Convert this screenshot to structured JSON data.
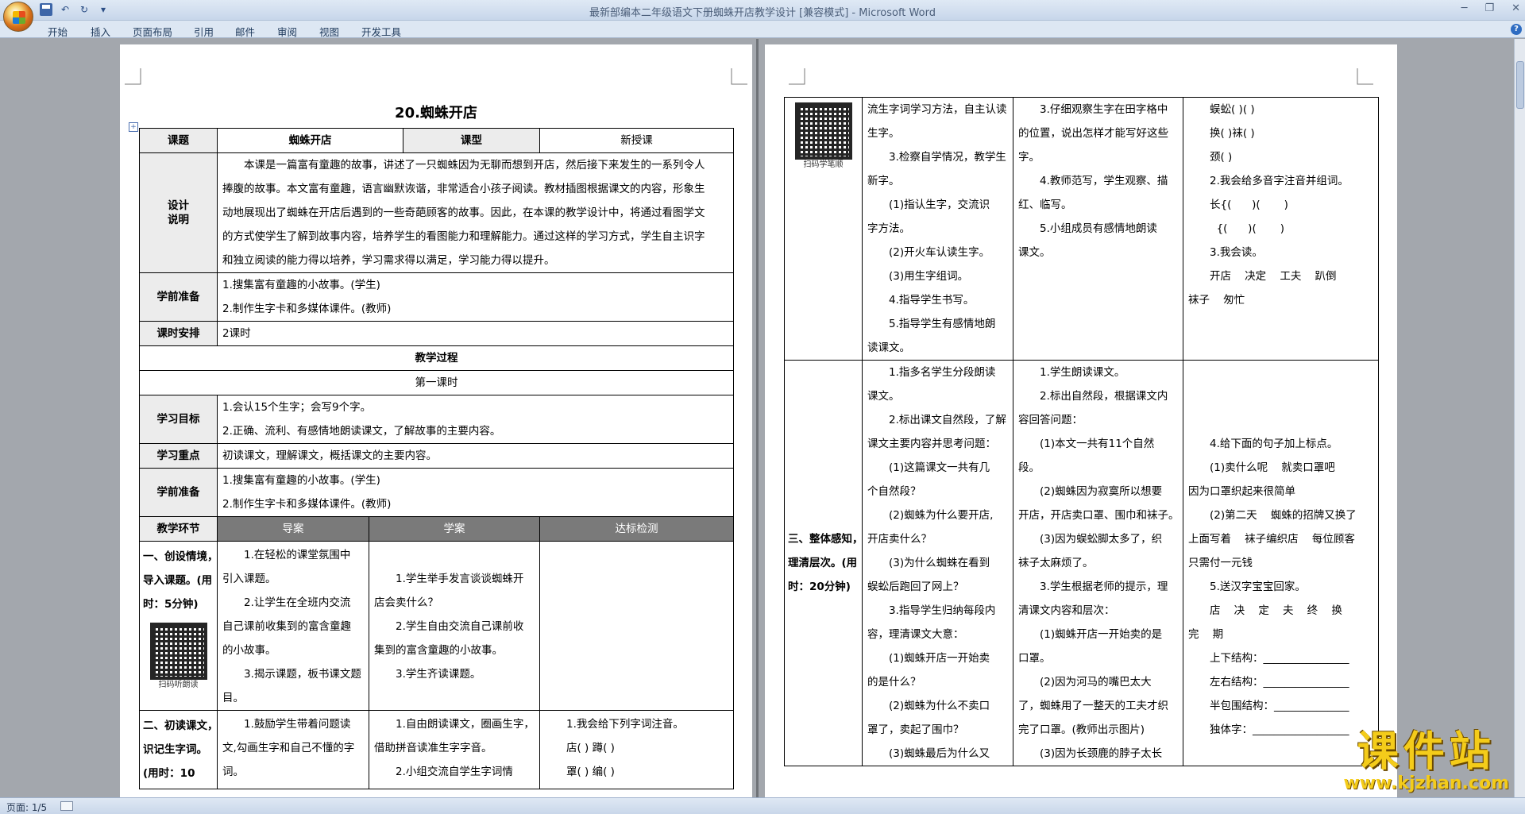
{
  "window": {
    "title": "最新部编本二年级语文下册蜘蛛开店教学设计 [兼容模式] - Microsoft Word"
  },
  "ribbon": {
    "tabs": [
      "开始",
      "插入",
      "页面布局",
      "引用",
      "邮件",
      "审阅",
      "视图",
      "开发工具"
    ]
  },
  "status": {
    "page": "页面: 1/5"
  },
  "doc": {
    "title": "20.蜘蛛开店",
    "lesson_label": "课题",
    "lesson_value": "蜘蛛开店",
    "type_label": "课型",
    "type_value": "新授课",
    "design_label": "设计说明",
    "design_lines": [
      "本课是一篇富有童趣的故事，讲述了一只蜘蛛因为无聊而想到开店，然后接下来发生的一系列令人",
      "捧腹的故事。本文富有童趣，语言幽默诙谐，非常适合小孩子阅读。教材插图根据课文的内容，形象生",
      "动地展现出了蜘蛛在开店后遇到的一些奇葩顾客的故事。因此，在本课的教学设计中，将通过看图学文",
      "的方式使学生了解到故事内容，培养学生的看图能力和理解能力。通过这样的学习方式，学生自主识字",
      "和独立阅读的能力得以培养，学习需求得以满足，学习能力得以提升。"
    ],
    "prep_label": "学前准备",
    "prep_lines": [
      "1.搜集富有童趣的小故事。(学生)",
      "2.制作生字卡和多媒体课件。(教师)"
    ],
    "hours_label": "课时安排",
    "hours_value": "2课时",
    "process": "教学过程",
    "period1": "第一课时",
    "goal_label": "学习目标",
    "goal_lines": [
      "1.会认15个生字；会写9个字。",
      "2.正确、流利、有感情地朗读课文，了解故事的主要内容。"
    ],
    "key_label": "学习重点",
    "key_value": "初读课文，理解课文，概括课文的主要内容。",
    "prep2_label": "学前准备",
    "prep2_lines": [
      "1.搜集富有童趣的小故事。(学生)",
      "2.制作生字卡和多媒体课件。(教师)"
    ],
    "step_head": [
      "教学环节",
      "导案",
      "学案",
      "达标检测"
    ],
    "step1_label": [
      "一、创设情境，",
      "导入课题。(用",
      "时：5分钟)"
    ],
    "step1_qr": "扫码听朗读",
    "step1_guide": [
      "1.在轻松的课堂氛围中",
      "引入课题。",
      "2.让学生在全班内交流",
      "自己课前收集到的富含童趣",
      "的小故事。",
      "3.揭示课题，板书课文题",
      "目。"
    ],
    "step1_learn": [
      "1.学生举手发言谈谈蜘蛛开",
      "店会卖什么？",
      "2.学生自由交流自己课前收",
      "集到的富含童趣的小故事。",
      "3.学生齐读课题。"
    ],
    "step2_label": [
      "二、初读课文，",
      "识记生字词。",
      "(用时：10"
    ],
    "step2_guide": [
      "1.鼓励学生带着问题读",
      "文,勾画生字和自己不懂的字",
      "词。"
    ],
    "step2_learn": [
      "1.自由朗读课文，圈画生字，",
      "借助拼音读准生字字音。",
      "2.小组交流自学生字词情"
    ],
    "step2_check": [
      "1.我会给下列字词注音。",
      "店(   )  蹲(   )",
      "罩(   )  编(   )"
    ],
    "p2_qr": "扫码学笔顺",
    "p2_a_col2": [
      "流生字词学习方法，自主认读",
      "生字。",
      "3.检察自学情况，教学生",
      "新字。",
      "(1)指认生字，交流识",
      "字方法。",
      "(2)开火车认读生字。",
      "(3)用生字组词。",
      "4.指导学生书写。",
      "5.指导学生有感情地朗",
      "读课文。"
    ],
    "p2_a_col3": [
      "3.仔细观察生字在田字格中",
      "的位置，说出怎样才能写好这些",
      "字。",
      "4.教师范写，学生观察、描",
      "红、临写。",
      "5.小组成员有感情地朗读",
      "课文。"
    ],
    "p2_a_col4": [
      "蜈蚣(   )(   )",
      "换(   )袜(   )",
      "颈(   )",
      "2.我会给多音字注音并组词。",
      "长{(      )(       )",
      "  {(      )(       )",
      "3.我会读。",
      "开店    决定    工夫    趴倒",
      "袜子    匆忙"
    ],
    "p2_b_label": [
      "三、整体感知，",
      "理清层次。(用",
      "时：20分钟)"
    ],
    "p2_b_col2": [
      "1.指多名学生分段朗读",
      "课文。",
      "2.标出课文自然段，了解",
      "课文主要内容并思考问题：",
      "(1)这篇课文一共有几",
      "个自然段？",
      "(2)蜘蛛为什么要开店,",
      "开店卖什么？",
      "(3)为什么蜘蛛在看到",
      "蜈蚣后跑回了网上？",
      "3.指导学生归纳每段内",
      "容，理清课文大意：",
      "(1)蜘蛛开店一开始卖",
      "的是什么？",
      "(2)蜘蛛为什么不卖口",
      "罩了，卖起了围巾？",
      "(3)蜘蛛最后为什么又"
    ],
    "p2_b_col3": [
      "1.学生朗读课文。",
      "2.标出自然段，根据课文内",
      "容回答问题：",
      "(1)本文一共有11个自然",
      "段。",
      "(2)蜘蛛因为寂寞所以想要",
      "开店，开店卖口罩、围巾和袜子。",
      "(3)因为蜈蚣脚太多了，织",
      "袜子太麻烦了。",
      "3.学生根据老师的提示，理",
      "清课文内容和层次：",
      "(1)蜘蛛开店一开始卖的是",
      "口罩。",
      "(2)因为河马的嘴巴太大",
      "了，蜘蛛用了一整天的工夫才织",
      "完了口罩。(教师出示图片)",
      "(3)因为长颈鹿的脖子太长"
    ],
    "p2_b_col4": [
      "",
      "",
      "",
      "4.给下面的句子加上标点。",
      "(1)卖什么呢    就卖口罩吧",
      "因为口罩织起来很简单",
      "(2)第二天    蜘蛛的招牌又换了",
      "上面写着    袜子编织店    每位顾客",
      "只需付一元钱",
      "5.送汉字宝宝回家。",
      "店    决    定    夫    终    换",
      "完    期",
      "上下结构：________________",
      "左右结构：________________",
      "半包围结构：______________",
      "独体字：__________________"
    ]
  }
}
